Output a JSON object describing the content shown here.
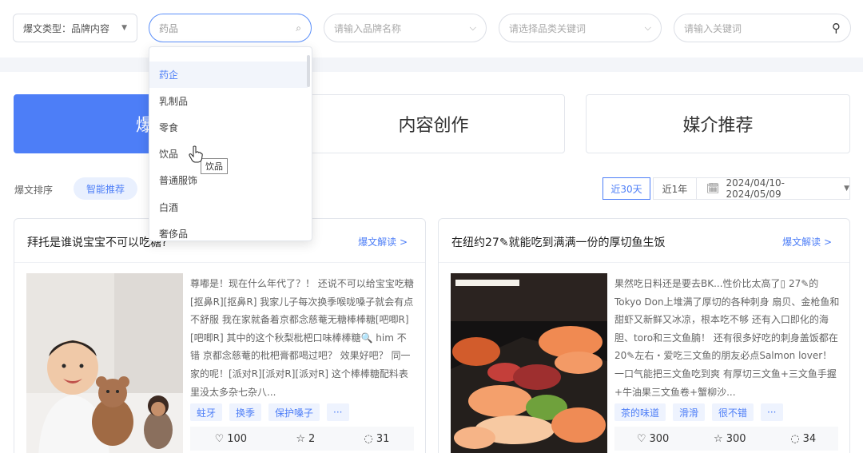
{
  "filters": {
    "type_label": "爆文类型：品牌内容",
    "drug_placeholder": "药品",
    "brand_placeholder": "请输入品牌名称",
    "category_placeholder": "请选择品类关键词",
    "keyword_placeholder": "请输入关键词",
    "icons": [
      "chevron-down-icon",
      "search-icon"
    ]
  },
  "dropdown": {
    "items": [
      {
        "label": "药企",
        "active": true
      },
      {
        "label": "乳制品",
        "active": false
      },
      {
        "label": "零食",
        "active": false
      },
      {
        "label": "饮品",
        "active": false
      },
      {
        "label": "普通服饰",
        "active": false
      },
      {
        "label": "白酒",
        "active": false
      },
      {
        "label": "奢侈品",
        "active": false
      }
    ],
    "tooltip": "饮品"
  },
  "tabs": [
    {
      "label": "爆文",
      "active": true
    },
    {
      "label": "内容创作",
      "active": false
    },
    {
      "label": "媒介推荐",
      "active": false
    }
  ],
  "sort": {
    "label": "爆文排序",
    "option": "智能推荐"
  },
  "range": {
    "days30": "近30天",
    "year1": "近1年",
    "date": "2024/04/10-2024/05/09"
  },
  "cards": [
    {
      "title": "拜托是谁说宝宝不可以吃糖?",
      "link": "爆文解读 >",
      "body": "尊嘟是！现在什么年代了？！ 还说不可以给宝宝吃糖[抠鼻R][抠鼻R] 我家儿子每次换季喉咙嗓子就会有点不舒服 我在家就备着京都念慈菴无糖棒棒糖[吧唧R][吧唧R] 其中的这个秋梨枇杷口味棒棒糖🔍 him 不错 京都念慈菴的枇杷膏都喝过吧？ 效果好吧？ 同一家的呢！[派对R][派对R][派对R] 这个棒棒糖配料表里没太多杂七杂八...",
      "tags": [
        "蛀牙",
        "换季",
        "保护嗓子",
        "···"
      ],
      "likes": "100",
      "favs": "2",
      "comments": "31"
    },
    {
      "title": "在纽约27✎就能吃到满满一份的厚切鱼生饭",
      "link": "爆文解读 >",
      "body": "果然吃日料还是要去BK...性价比太高了▯ 27✎的Tokyo Don上堆满了厚切的各种刺身 扇贝、金枪鱼和甜虾又新鲜又冰凉，根本吃不够 还有入口即化的海胆、toro和三文鱼腩！ 还有很多好吃的刺身盖饭都在20✎左右・爱吃三文鱼的朋友必点Salmon lover！ 一口气能把三文鱼吃到爽 有厚切三文鱼+三文鱼手握+牛油果三文鱼卷+蟹柳沙...",
      "tags": [
        "茶的味道",
        "滑滑",
        "很不错",
        "···"
      ],
      "likes": "300",
      "favs": "300",
      "comments": "34"
    }
  ]
}
